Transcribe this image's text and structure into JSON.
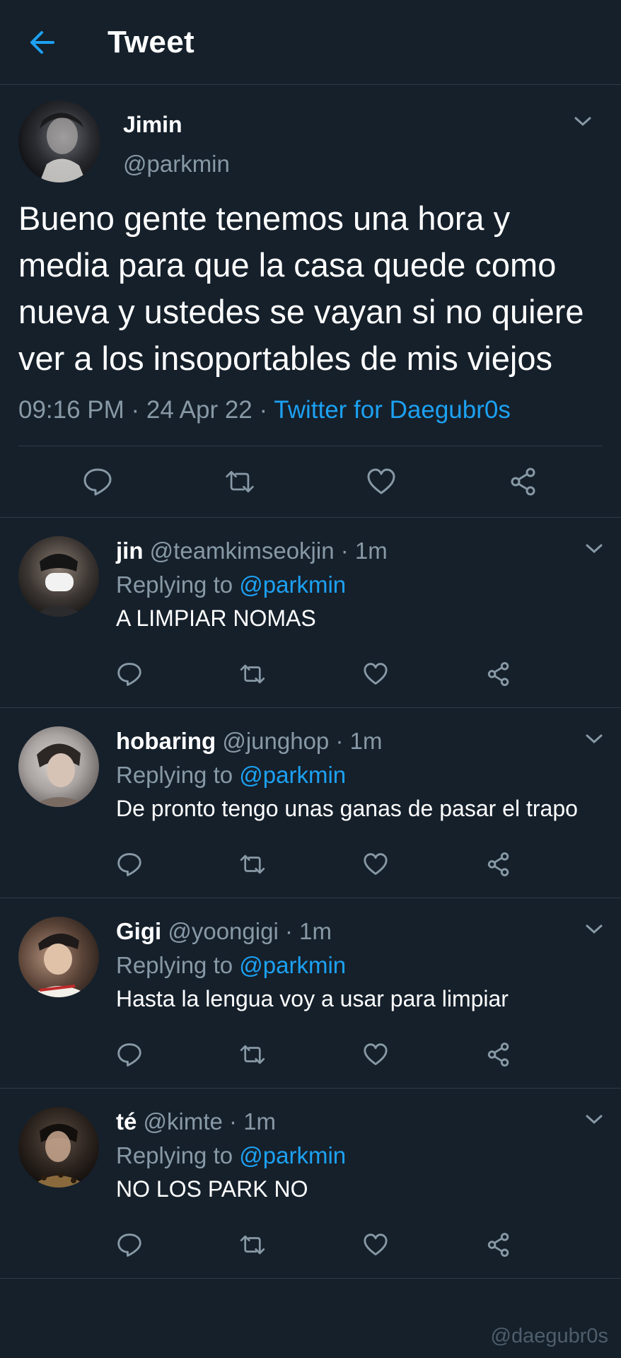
{
  "header": {
    "title": "Tweet",
    "back_icon": "arrow-left-icon"
  },
  "colors": {
    "background": "#15202b",
    "accent": "#1da1f2",
    "muted": "#8899a6",
    "divider": "#2f3b47"
  },
  "main_tweet": {
    "name": "Jimin",
    "handle": "@parkmin",
    "text": "Bueno gente tenemos una hora y media para que la casa quede como nueva y ustedes se vayan si no quiere ver a los insoportables de mis viejos",
    "time": "09:16 PM",
    "date": "24 Apr 22",
    "source": "Twitter for Daegubr0s",
    "sep": " · "
  },
  "replies": [
    {
      "name": "jin",
      "handle": "@teamkimseokjin",
      "time": "1m",
      "replying_prefix": "Replying to ",
      "mention": "@parkmin",
      "text": "A LIMPIAR NOMAS"
    },
    {
      "name": "hobaring",
      "handle": "@junghop",
      "time": "1m",
      "replying_prefix": "Replying to ",
      "mention": "@parkmin",
      "text": "De pronto tengo unas ganas de pasar el trapo"
    },
    {
      "name": "Gigi",
      "handle": "@yoongigi",
      "time": "1m",
      "replying_prefix": "Replying to ",
      "mention": "@parkmin",
      "text": "Hasta la lengua voy a usar para limpiar"
    },
    {
      "name": "té",
      "handle": "@kimte",
      "time": "1m",
      "replying_prefix": "Replying to ",
      "mention": "@parkmin",
      "text": "NO LOS PARK NO"
    }
  ],
  "dot": "·",
  "watermark": "@daegubr0s"
}
